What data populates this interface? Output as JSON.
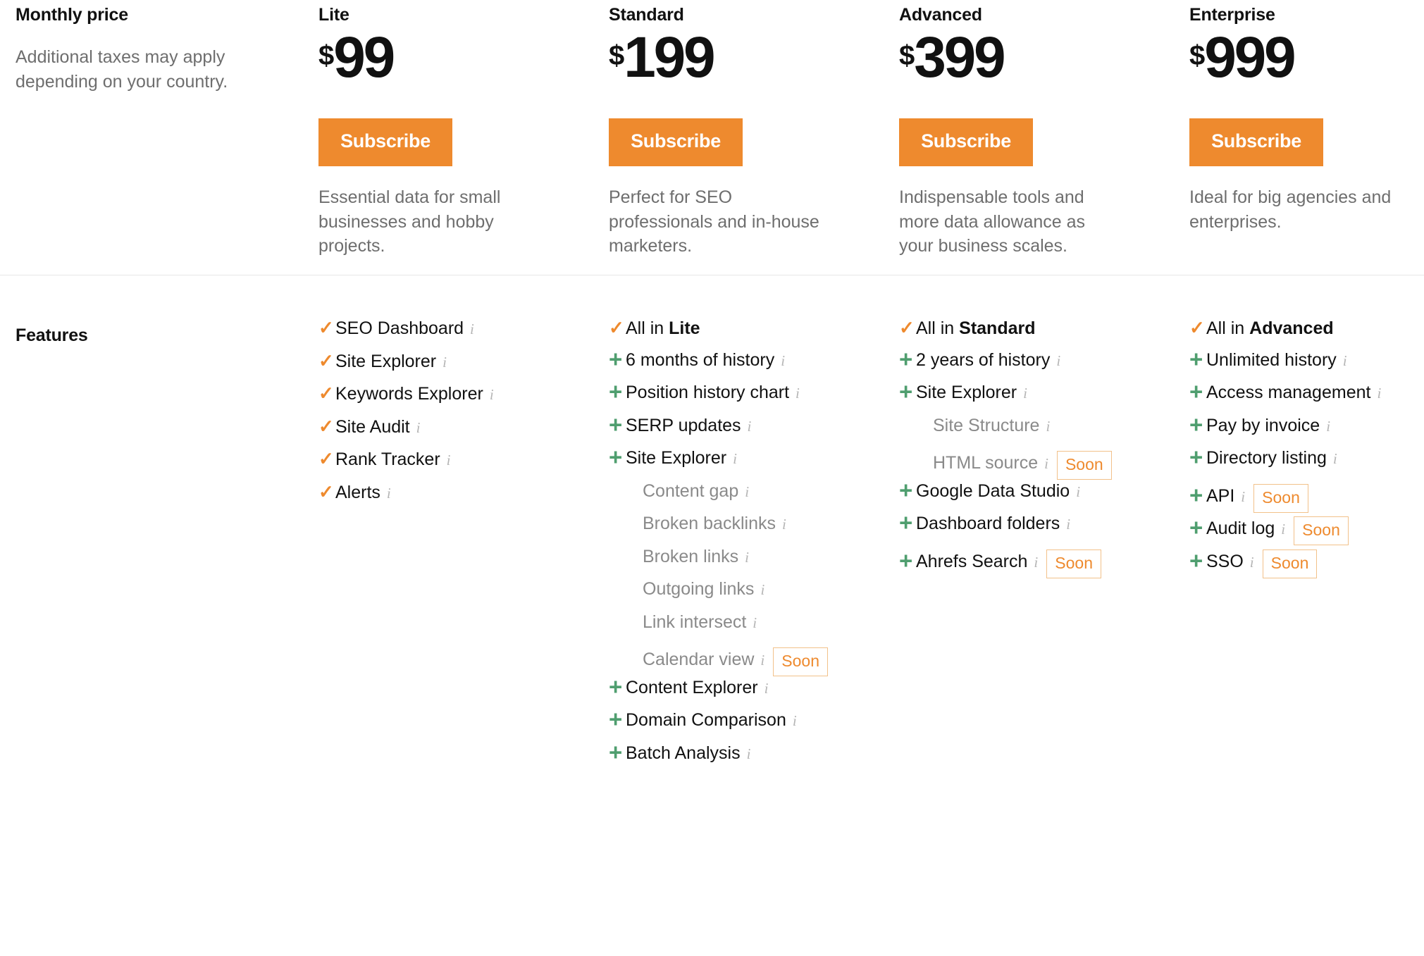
{
  "price_section": {
    "label": "Monthly price",
    "note": "Additional taxes may apply depending on your country.",
    "currency": "$",
    "subscribe_label": "Subscribe",
    "plans": [
      {
        "name": "Lite",
        "amount": "99",
        "description": "Essential data for small businesses and hobby projects."
      },
      {
        "name": "Standard",
        "amount": "199",
        "description": "Perfect for SEO professionals and in-house marketers."
      },
      {
        "name": "Advanced",
        "amount": "399",
        "description": "Indispensable tools and more data allowance as your business scales."
      },
      {
        "name": "Enterprise",
        "amount": "999",
        "description": "Ideal for big agencies and enterprises."
      }
    ]
  },
  "features_section": {
    "label": "Features",
    "soon_badge": "Soon",
    "info_glyph": "i",
    "check_glyph": "✓",
    "plus_glyph": "+",
    "columns": [
      {
        "plan": "Lite",
        "items": [
          {
            "mark": "check",
            "label": "SEO Dashboard",
            "info": true,
            "soon": false,
            "indent": false,
            "muted": false
          },
          {
            "mark": "check",
            "label": "Site Explorer",
            "info": true,
            "soon": false,
            "indent": false,
            "muted": false
          },
          {
            "mark": "check",
            "label": "Keywords Explorer",
            "info": true,
            "soon": false,
            "indent": false,
            "muted": false
          },
          {
            "mark": "check",
            "label": "Site Audit",
            "info": true,
            "soon": false,
            "indent": false,
            "muted": false
          },
          {
            "mark": "check",
            "label": "Rank Tracker",
            "info": true,
            "soon": false,
            "indent": false,
            "muted": false
          },
          {
            "mark": "check",
            "label": "Alerts",
            "info": true,
            "soon": false,
            "indent": false,
            "muted": false
          }
        ]
      },
      {
        "plan": "Standard",
        "items": [
          {
            "mark": "check",
            "label": "All in ",
            "bold_suffix": "Lite",
            "info": false,
            "soon": false,
            "indent": false,
            "muted": false
          },
          {
            "mark": "plus",
            "label": "6 months of history",
            "info": true,
            "soon": false,
            "indent": false,
            "muted": false
          },
          {
            "mark": "plus",
            "label": "Position history chart",
            "info": true,
            "soon": false,
            "indent": false,
            "muted": false
          },
          {
            "mark": "plus",
            "label": "SERP updates",
            "info": true,
            "soon": false,
            "indent": false,
            "muted": false
          },
          {
            "mark": "plus",
            "label": "Site Explorer",
            "info": true,
            "soon": false,
            "indent": false,
            "muted": false
          },
          {
            "mark": "none",
            "label": "Content gap",
            "info": true,
            "soon": false,
            "indent": true,
            "muted": true
          },
          {
            "mark": "none",
            "label": "Broken backlinks",
            "info": true,
            "soon": false,
            "indent": true,
            "muted": true
          },
          {
            "mark": "none",
            "label": "Broken links",
            "info": true,
            "soon": false,
            "indent": true,
            "muted": true
          },
          {
            "mark": "none",
            "label": "Outgoing links",
            "info": true,
            "soon": false,
            "indent": true,
            "muted": true
          },
          {
            "mark": "none",
            "label": "Link intersect",
            "info": true,
            "soon": false,
            "indent": true,
            "muted": true
          },
          {
            "mark": "none",
            "label": "Calendar view",
            "info": true,
            "soon": true,
            "indent": true,
            "muted": true
          },
          {
            "mark": "plus",
            "label": "Content Explorer",
            "info": true,
            "soon": false,
            "indent": false,
            "muted": false
          },
          {
            "mark": "plus",
            "label": "Domain Comparison",
            "info": true,
            "soon": false,
            "indent": false,
            "muted": false
          },
          {
            "mark": "plus",
            "label": "Batch Analysis",
            "info": true,
            "soon": false,
            "indent": false,
            "muted": false
          }
        ]
      },
      {
        "plan": "Advanced",
        "items": [
          {
            "mark": "check",
            "label": "All in ",
            "bold_suffix": "Standard",
            "info": false,
            "soon": false,
            "indent": false,
            "muted": false
          },
          {
            "mark": "plus",
            "label": "2 years of history",
            "info": true,
            "soon": false,
            "indent": false,
            "muted": false
          },
          {
            "mark": "plus",
            "label": "Site Explorer",
            "info": true,
            "soon": false,
            "indent": false,
            "muted": false
          },
          {
            "mark": "none",
            "label": "Site Structure",
            "info": true,
            "soon": false,
            "indent": true,
            "muted": true
          },
          {
            "mark": "none",
            "label": "HTML source",
            "info": true,
            "soon": true,
            "indent": true,
            "muted": true
          },
          {
            "mark": "plus",
            "label": "Google Data Studio",
            "info": true,
            "soon": false,
            "indent": false,
            "muted": false
          },
          {
            "mark": "plus",
            "label": "Dashboard folders",
            "info": true,
            "soon": false,
            "indent": false,
            "muted": false
          },
          {
            "mark": "plus",
            "label": "Ahrefs Search",
            "info": true,
            "soon": true,
            "indent": false,
            "muted": false
          }
        ]
      },
      {
        "plan": "Enterprise",
        "items": [
          {
            "mark": "check",
            "label": "All in ",
            "bold_suffix": "Advanced",
            "info": false,
            "soon": false,
            "indent": false,
            "muted": false
          },
          {
            "mark": "plus",
            "label": "Unlimited history",
            "info": true,
            "soon": false,
            "indent": false,
            "muted": false
          },
          {
            "mark": "plus",
            "label": "Access management",
            "info": true,
            "soon": false,
            "indent": false,
            "muted": false
          },
          {
            "mark": "plus",
            "label": "Pay by invoice",
            "info": true,
            "soon": false,
            "indent": false,
            "muted": false
          },
          {
            "mark": "plus",
            "label": "Directory listing",
            "info": true,
            "soon": false,
            "indent": false,
            "muted": false
          },
          {
            "mark": "plus",
            "label": "API",
            "info": true,
            "soon": true,
            "indent": false,
            "muted": false
          },
          {
            "mark": "plus",
            "label": "Audit log",
            "info": true,
            "soon": true,
            "indent": false,
            "muted": false
          },
          {
            "mark": "plus",
            "label": "SSO",
            "info": true,
            "soon": true,
            "indent": false,
            "muted": false
          }
        ]
      }
    ]
  },
  "colors": {
    "accent_orange": "#ee8a2e",
    "plus_green": "#4f9e6f",
    "muted_text": "#8a8a8a",
    "divider": "#e6e6e6"
  }
}
